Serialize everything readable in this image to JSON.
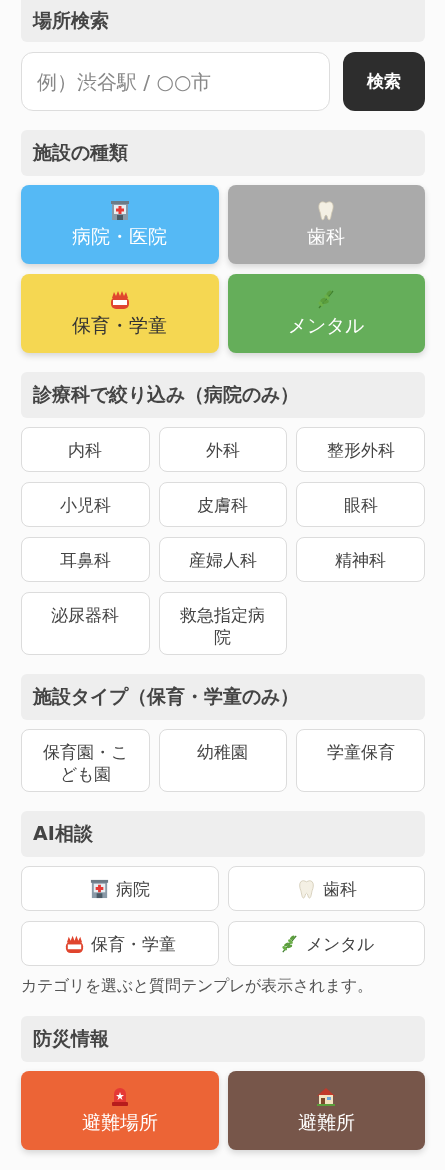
{
  "search": {
    "heading": "場所検索",
    "placeholder": "例）渋谷駅 / ○○市",
    "button": "検索"
  },
  "facility_types": {
    "heading": "施設の種類",
    "items": [
      {
        "label": "病院・医院",
        "kind": "hospital",
        "color": "#55b9f5"
      },
      {
        "label": "歯科",
        "kind": "tooth",
        "color": "#aaaaaa"
      },
      {
        "label": "保育・学童",
        "kind": "badge",
        "color": "#f5d752"
      },
      {
        "label": "メンタル",
        "kind": "leaf",
        "color": "#65ae5a"
      }
    ]
  },
  "departments": {
    "heading": "診療科で絞り込み（病院のみ）",
    "items": [
      "内科",
      "外科",
      "整形外科",
      "小児科",
      "皮膚科",
      "眼科",
      "耳鼻科",
      "産婦人科",
      "精神科",
      "泌尿器科",
      "救急指定病院"
    ]
  },
  "facility_subtypes": {
    "heading": "施設タイプ（保育・学童のみ）",
    "items": [
      "保育園・こども園",
      "幼稚園",
      "学童保育"
    ]
  },
  "ai_consult": {
    "heading": "AI相談",
    "items": [
      {
        "label": "病院",
        "kind": "hospital"
      },
      {
        "label": "歯科",
        "kind": "tooth"
      },
      {
        "label": "保育・学童",
        "kind": "badge"
      },
      {
        "label": "メンタル",
        "kind": "leaf"
      }
    ],
    "note": "カテゴリを選ぶと質問テンプレが表示されます。"
  },
  "disaster": {
    "heading": "防災情報",
    "items": [
      {
        "label": "避難場所",
        "kind": "siren",
        "color": "#ec6436"
      },
      {
        "label": "避難所",
        "kind": "house",
        "color": "#77564a"
      }
    ]
  }
}
